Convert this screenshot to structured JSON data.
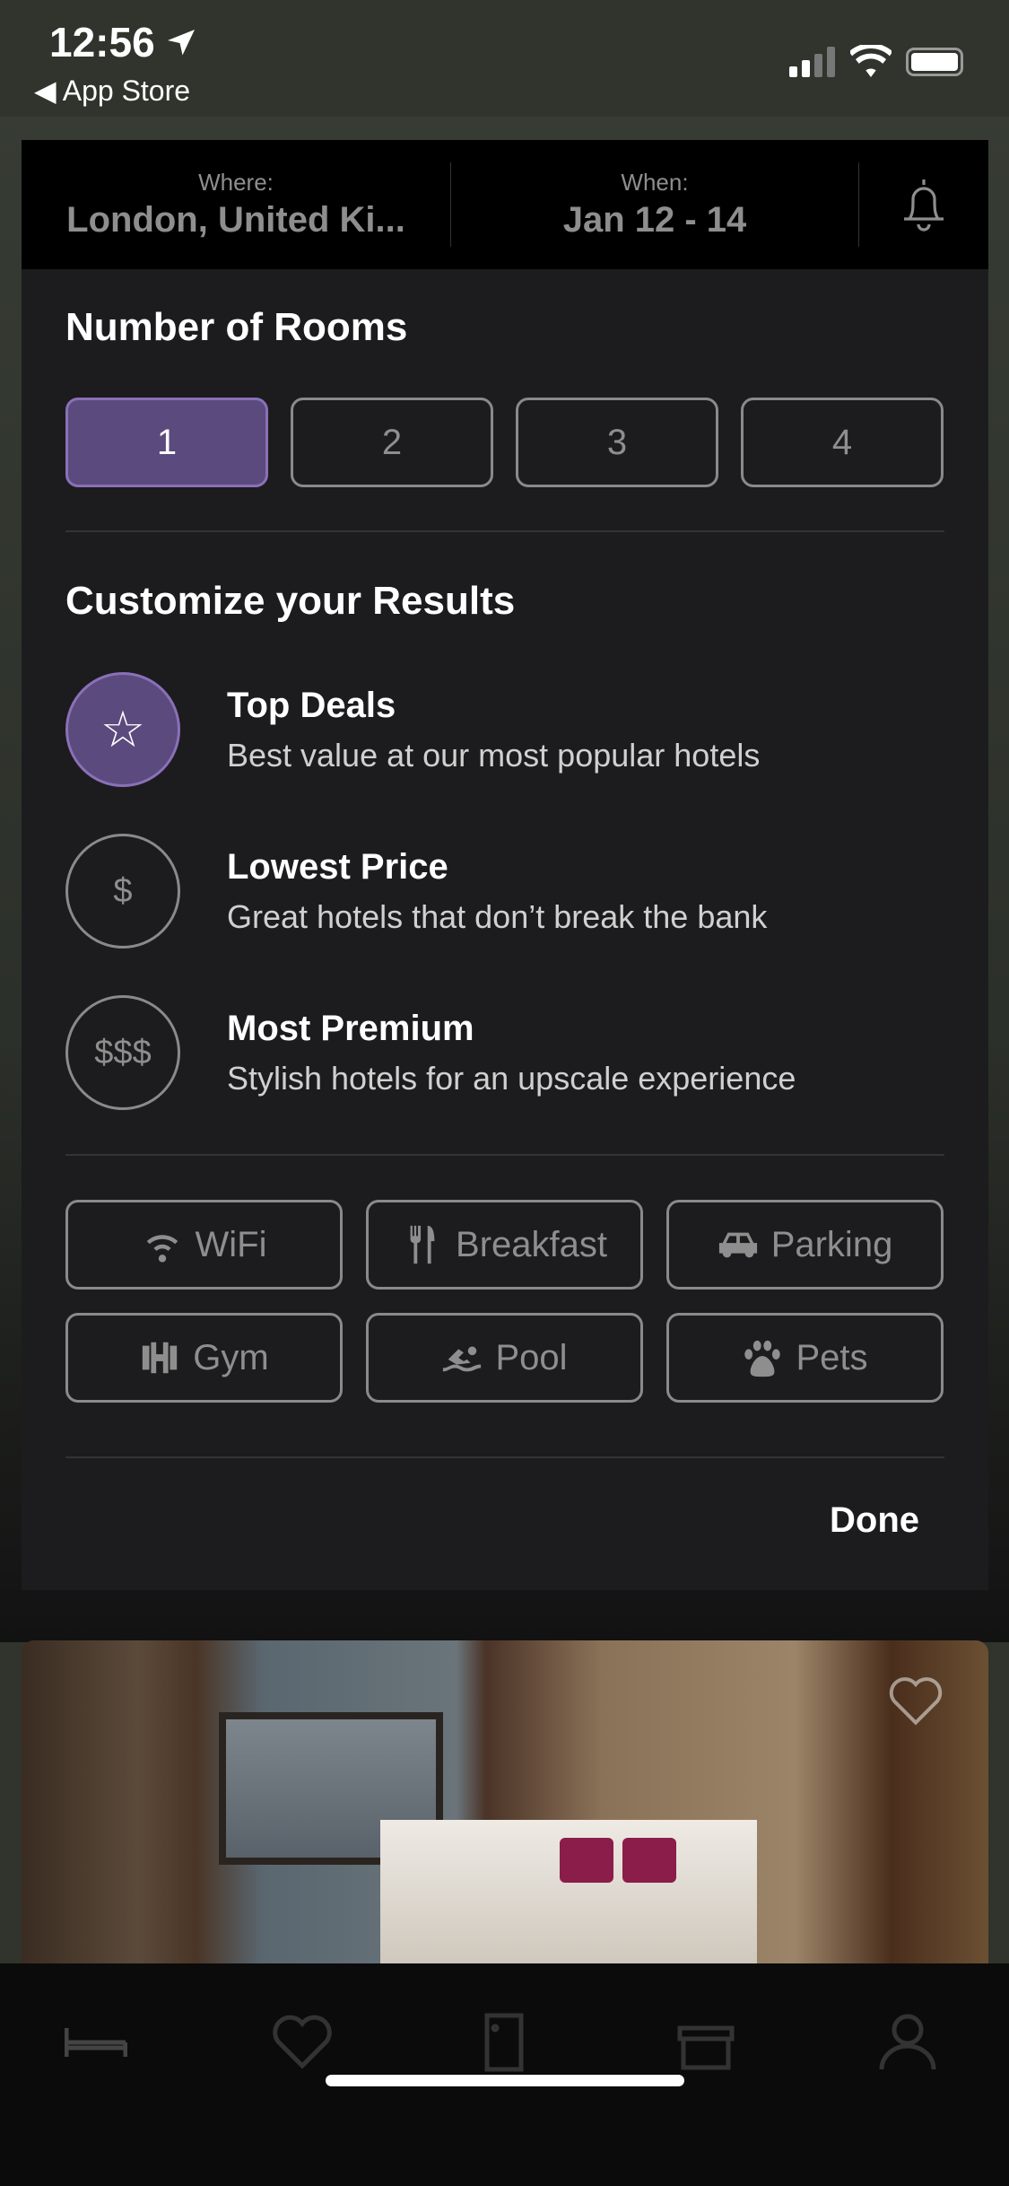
{
  "status_bar": {
    "time": "12:56",
    "back_label": "App Store"
  },
  "header": {
    "where_label": "Where:",
    "where_value": "London, United Ki...",
    "when_label": "When:",
    "when_value": "Jan 12 - 14"
  },
  "rooms": {
    "title": "Number of Rooms",
    "options": [
      "1",
      "2",
      "3",
      "4"
    ],
    "selected": "1"
  },
  "customize": {
    "title": "Customize your Results",
    "options": [
      {
        "icon": "star-icon",
        "symbol": "☆",
        "title": "Top Deals",
        "subtitle": "Best value at our most popular hotels",
        "selected": true
      },
      {
        "icon": "dollar-icon",
        "symbol": "$",
        "title": "Lowest Price",
        "subtitle": "Great hotels that don’t break the bank",
        "selected": false
      },
      {
        "icon": "triple-dollar-icon",
        "symbol": "$$$",
        "title": "Most Premium",
        "subtitle": "Stylish hotels for an upscale experience",
        "selected": false
      }
    ]
  },
  "amenities": [
    {
      "label": "WiFi",
      "icon": "wifi-icon"
    },
    {
      "label": "Breakfast",
      "icon": "fork-knife-icon"
    },
    {
      "label": "Parking",
      "icon": "car-icon"
    },
    {
      "label": "Gym",
      "icon": "dumbbell-icon"
    },
    {
      "label": "Pool",
      "icon": "swimmer-icon"
    },
    {
      "label": "Pets",
      "icon": "paw-icon"
    }
  ],
  "done_label": "Done",
  "colors": {
    "accent": "#5b4a7e",
    "accent_border": "#8a70b8",
    "sheet": "#1c1c1e"
  }
}
